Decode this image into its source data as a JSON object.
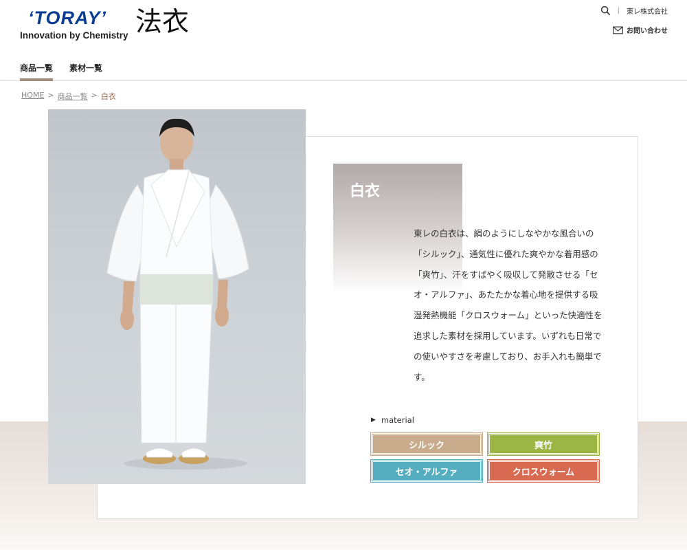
{
  "header": {
    "logo_word": "ʻTORAYʼ",
    "logo_tagline": "Innovation by Chemistry",
    "site_title": "法衣",
    "company_link": "東レ株式会社",
    "contact_label": "お問い合わせ",
    "brand_color": "#0a3d91"
  },
  "nav": {
    "items": [
      {
        "label": "商品一覧",
        "active": true
      },
      {
        "label": "素材一覧",
        "active": false
      }
    ],
    "active_color": "#a08c7a"
  },
  "breadcrumb": {
    "items": [
      "HOME",
      "商品一覧"
    ],
    "separator": ">",
    "current": "白衣"
  },
  "product": {
    "title": "白衣",
    "description": "東レの白衣は、絹のようにしなやかな風合いの「シルック」、通気性に優れた爽やかな着用感の「爽竹」、汗をすばやく吸収して発散させる「セオ・アルファ」、あたたかな着心地を提供する吸湿発熱機能「クロスウォーム」といった快適性を追求した素材を採用しています。いずれも日常での使いやすさを考慮しており、お手入れも簡単です。",
    "material_heading": "material",
    "materials": [
      {
        "label": "シルック",
        "color": "#c8ac8c"
      },
      {
        "label": "爽竹",
        "color": "#9cb545"
      },
      {
        "label": "セオ・アルファ",
        "color": "#55adc0"
      },
      {
        "label": "クロスウォーム",
        "color": "#d86a52"
      }
    ]
  }
}
